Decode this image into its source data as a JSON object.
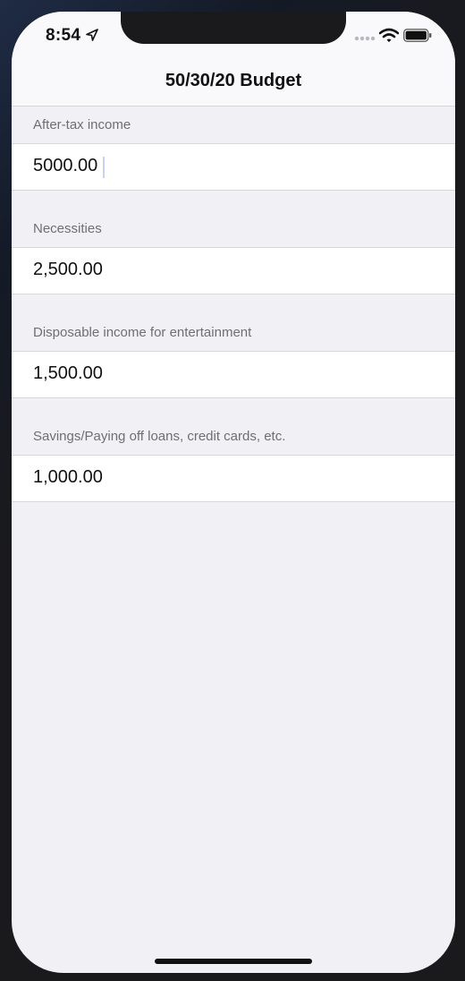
{
  "status_bar": {
    "time": "8:54",
    "icons": [
      "location-arrow-icon",
      "signal-dots-icon",
      "wifi-icon",
      "battery-icon"
    ]
  },
  "nav": {
    "title": "50/30/20 Budget"
  },
  "form": {
    "sections": [
      {
        "header": "After-tax income",
        "value": "5000.00",
        "editable": true
      },
      {
        "header": "Necessities",
        "value": "2,500.00",
        "editable": false
      },
      {
        "header": "Disposable income for entertainment",
        "value": "1,500.00",
        "editable": false
      },
      {
        "header": "Savings/Paying off loans, credit cards, etc.",
        "value": "1,000.00",
        "editable": false
      }
    ]
  },
  "colors": {
    "background": "#f1f1f5",
    "row_background": "#ffffff",
    "header_text": "#6e6e73",
    "caret": "#c9d2ee"
  }
}
